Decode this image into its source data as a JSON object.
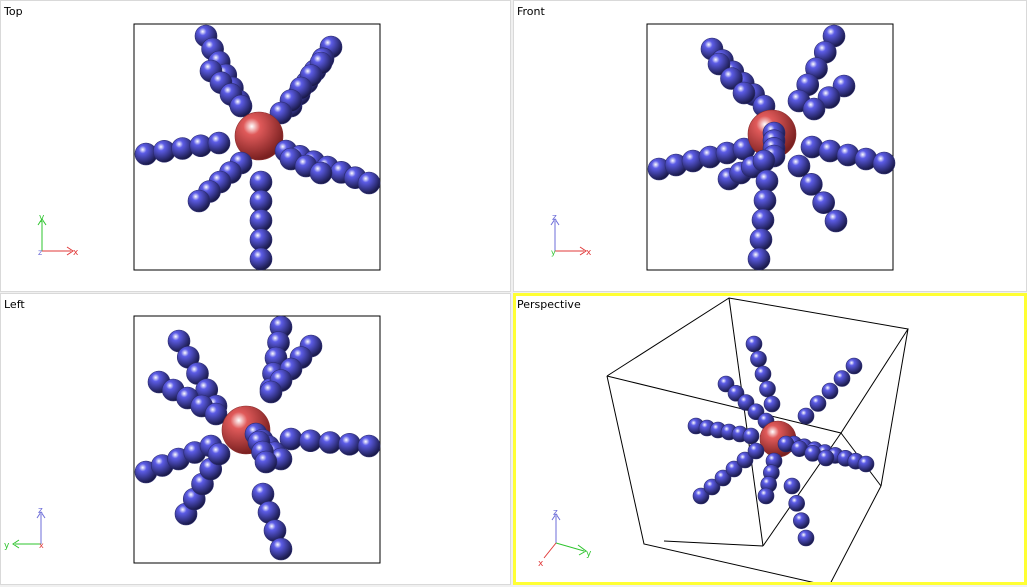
{
  "viewports": {
    "top": {
      "label": "Top",
      "axes": {
        "up": "y",
        "right": "x",
        "center": "z"
      }
    },
    "front": {
      "label": "Front",
      "axes": {
        "up": "z",
        "right": "x",
        "center": "y"
      }
    },
    "left": {
      "label": "Left",
      "axes": {
        "up": "z",
        "left": "y",
        "center": "x"
      }
    },
    "perspective": {
      "label": "Perspective",
      "axes": {
        "up": "z",
        "right": "y",
        "left": "x"
      },
      "active": true
    }
  },
  "colors": {
    "atom_center": "#e05a5a",
    "atom_chain": "#5c5ce6",
    "axis_x": "#e03a3a",
    "axis_y": "#2ec42e",
    "axis_z": "#6c6cd8",
    "active_border": "#ffff33"
  }
}
